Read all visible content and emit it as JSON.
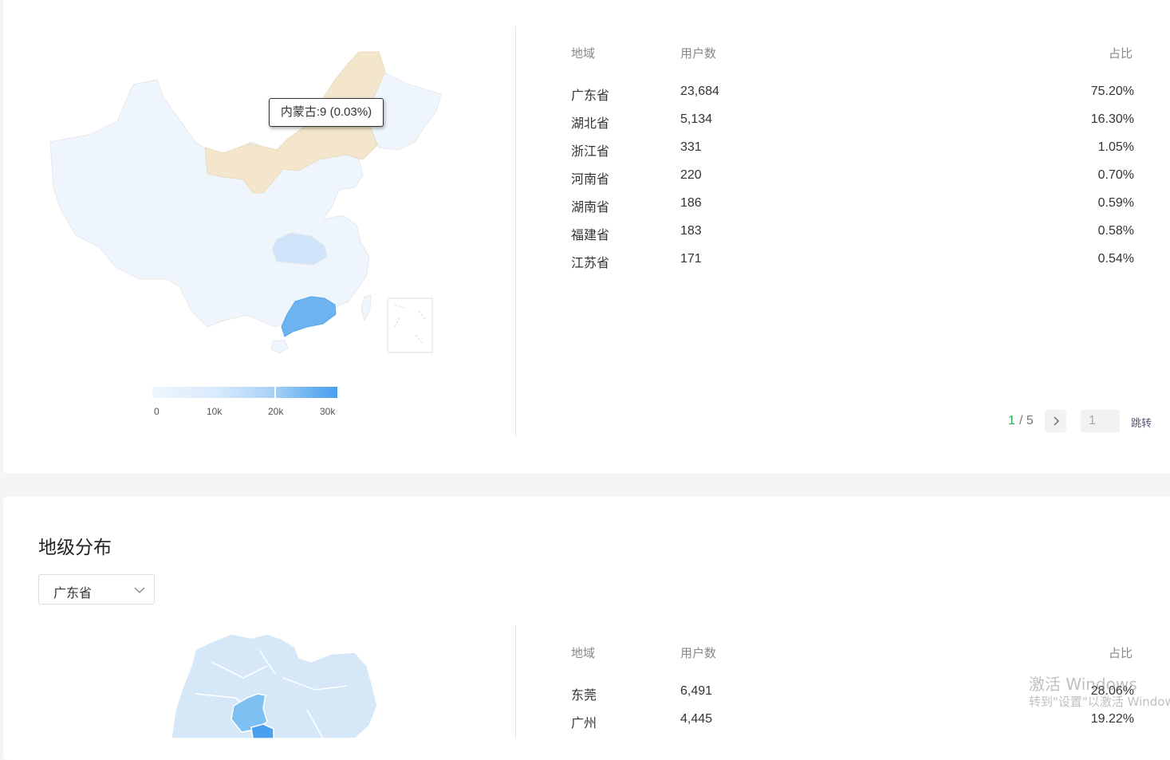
{
  "province_map": {
    "tooltip": "内蒙古:9 (0.03%)",
    "legend_ticks": [
      "0",
      "10k",
      "20k",
      "30k"
    ],
    "colors": {
      "low": "#eef5fc",
      "mid": "#cfe4f8",
      "high": "#6cb3f0",
      "hover": "#f3e6cc"
    }
  },
  "province_table": {
    "headers": {
      "region": "地域",
      "users": "用户数",
      "share": "占比"
    },
    "rows": [
      {
        "region": "广东省",
        "users": "23,684",
        "share": "75.20%"
      },
      {
        "region": "湖北省",
        "users": "5,134",
        "share": "16.30%"
      },
      {
        "region": "浙江省",
        "users": "331",
        "share": "1.05%"
      },
      {
        "region": "河南省",
        "users": "220",
        "share": "0.70%"
      },
      {
        "region": "湖南省",
        "users": "186",
        "share": "0.59%"
      },
      {
        "region": "福建省",
        "users": "183",
        "share": "0.58%"
      },
      {
        "region": "江苏省",
        "users": "171",
        "share": "0.54%"
      }
    ],
    "pagination": {
      "current": "1",
      "total": "/ 5",
      "next_icon": "chevron-right-icon",
      "jump_value": "1",
      "jump_label": "跳转"
    }
  },
  "city_section": {
    "title": "地级分布",
    "select_value": "广东省",
    "select_icon": "chevron-down-icon",
    "table": {
      "headers": {
        "region": "地域",
        "users": "用户数",
        "share": "占比"
      },
      "rows": [
        {
          "region": "东莞",
          "users": "6,491",
          "share": "28.06%"
        },
        {
          "region": "广州",
          "users": "4,445",
          "share": "19.22%"
        }
      ]
    }
  },
  "watermark": {
    "line1": "激活 Windows",
    "line2": "转到\"设置\"以激活 Windows。"
  }
}
